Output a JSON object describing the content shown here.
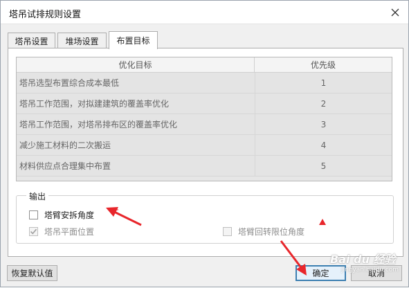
{
  "window": {
    "title": "塔吊试排规则设置"
  },
  "tabs": [
    {
      "label": "塔吊设置",
      "active": false
    },
    {
      "label": "堆场设置",
      "active": false
    },
    {
      "label": "布置目标",
      "active": true
    }
  ],
  "table": {
    "columns": [
      "优化目标",
      "优先级"
    ],
    "rows": [
      {
        "goal": "塔吊选型布置综合成本最低",
        "priority": "1"
      },
      {
        "goal": "塔吊工作范围，对拟建建筑的覆盖率优化",
        "priority": "2"
      },
      {
        "goal": "塔吊工作范围，对塔吊排布区的覆盖率优化",
        "priority": "3"
      },
      {
        "goal": "减少施工材料的二次搬运",
        "priority": "4"
      },
      {
        "goal": "材料供应点合理集中布置",
        "priority": "5"
      }
    ]
  },
  "output": {
    "label": "输出",
    "options": [
      {
        "label": "塔臂安拆角度",
        "checked": false,
        "enabled": true
      },
      {
        "label": "塔吊平面位置",
        "checked": true,
        "enabled": false
      },
      {
        "label": "塔臂回转限位角度",
        "checked": false,
        "enabled": false
      }
    ]
  },
  "buttons": {
    "restore_defaults": "恢复默认值",
    "ok": "确定",
    "cancel": "取消"
  },
  "watermark": {
    "brand": "Bai du 经验",
    "url": "jingyan.baidu.com"
  },
  "colors": {
    "annotation_red": "#e8262b",
    "primary_border": "#3c7fb1",
    "check_mark_disabled": "#a0a0a0"
  },
  "icons": {
    "close": "close-icon",
    "check": "check-mark-icon"
  }
}
